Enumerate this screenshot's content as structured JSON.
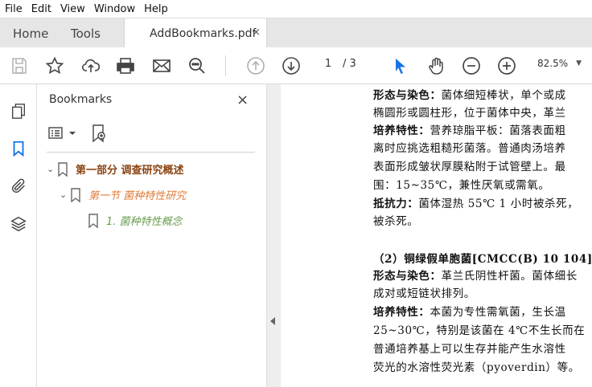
{
  "menu": [
    "File",
    "Edit",
    "View",
    "Window",
    "Help"
  ],
  "tabs": {
    "home": "Home",
    "tools": "Tools",
    "doc": "AddBookmarks.pdf",
    "close": "×"
  },
  "toolbar": {
    "page_current": "1",
    "page_total": "/ 3",
    "zoom": "82.5%",
    "zoom_caret": "▼"
  },
  "panel": {
    "title": "Bookmarks",
    "close": "×",
    "items": [
      {
        "label": "第一部分 调查研究概述",
        "color": "#8b4513"
      },
      {
        "label": "第一节 菌种特性研究",
        "color": "#e07b39"
      },
      {
        "label": "1. 菌种特性概念",
        "color": "#6b9e4f"
      }
    ]
  },
  "document": {
    "lines": [
      {
        "bold": "形态与染色：",
        "text": "菌体细短棒状，单个或成"
      },
      {
        "bold": "",
        "text": "椭圆形或圆柱形，位于菌体中央，革兰"
      },
      {
        "bold": "培养特性：",
        "text": "营养琼脂平板：菌落表面粗"
      },
      {
        "bold": "",
        "text": "离时应挑选粗糙形菌落。普通肉汤培养"
      },
      {
        "bold": "",
        "text": "表面形成皱状厚膜粘附于试管壁上。最"
      },
      {
        "bold": "",
        "text": "围：15~35℃，兼性厌氧或需氧。"
      },
      {
        "bold": "抵抗力：",
        "text": "菌体湿热 55℃ 1 小时被杀死，"
      },
      {
        "bold": "",
        "text": "被杀死。"
      },
      {
        "bold": "（2）铜绿假单胞菌[CMCC(B) 10 104]",
        "text": ""
      },
      {
        "bold": "形态与染色：",
        "text": "革兰氏阴性杆菌。菌体细长"
      },
      {
        "bold": "",
        "text": "成对或短链状排列。"
      },
      {
        "bold": "培养特性：",
        "text": "本菌为专性需氧菌，生长温"
      },
      {
        "bold": "",
        "text": "25~30℃，特别是该菌在 4℃不生长而在"
      },
      {
        "bold": "",
        "text": "普通培养基上可以生存并能产生水溶性"
      },
      {
        "bold": "",
        "text": "荧光的水溶性荧光素（pyoverdin）等。"
      }
    ]
  }
}
